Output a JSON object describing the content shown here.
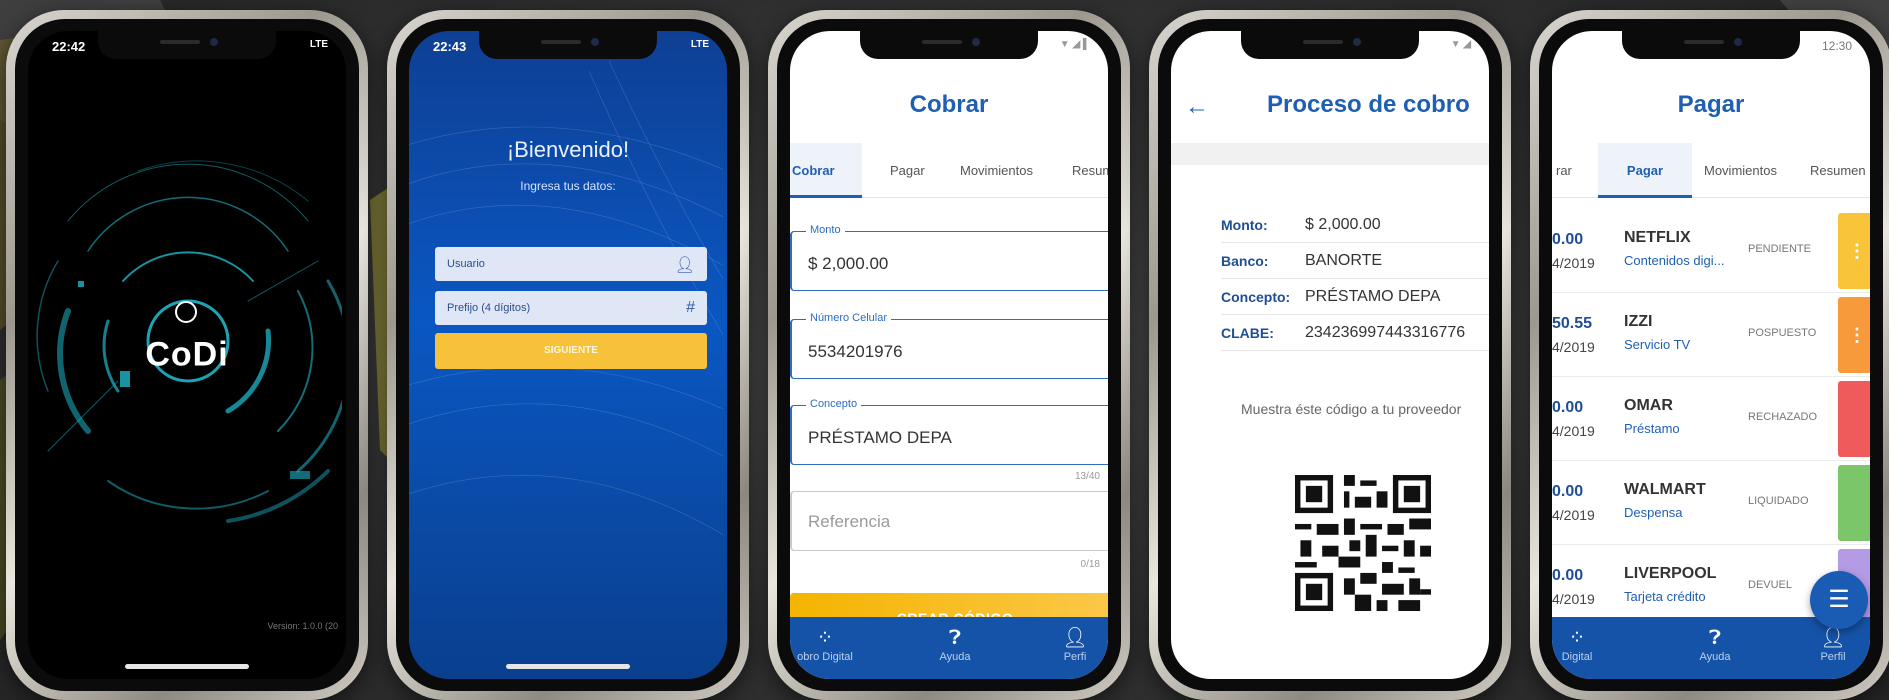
{
  "colors": {
    "primary_blue": "#1f5fb2",
    "accent_yellow": "#f8c13a",
    "nav_blue": "#1553a8",
    "status_pendiente": "#f8c53a",
    "status_pospuesto": "#f79a3b",
    "status_rechazado": "#ef5b5b",
    "status_liquidado": "#7cc66a",
    "status_devuelto": "#b59be3"
  },
  "phone1": {
    "time": "22:42",
    "status_right": "LTE",
    "logo_text": "CoDi",
    "version": "Version: 1.0.0 (20"
  },
  "phone2": {
    "time": "22:43",
    "status_right": "LTE",
    "welcome": "¡Bienvenido!",
    "subtitle": "Ingresa tus datos:",
    "user_placeholder": "Usuario",
    "prefix_placeholder": "Prefijo (4 dígitos)",
    "prefix_icon": "hash-icon",
    "user_icon": "person-icon",
    "button": "SIGUIENTE"
  },
  "phone3": {
    "title": "Cobrar",
    "tabs": [
      "Cobrar",
      "Pagar",
      "Movimientos",
      "Resum"
    ],
    "active_tab": "Cobrar",
    "monto_label": "Monto",
    "monto_value": "$ 2,000.00",
    "celular_label": "Número Celular",
    "celular_value": "5534201976",
    "concepto_label": "Concepto",
    "concepto_value": "PRÉSTAMO DEPA",
    "concepto_counter": "13/40",
    "referencia_placeholder": "Referencia",
    "referencia_counter": "0/18",
    "button": "CREAR CÓDIGO",
    "nav": [
      "obro Digital",
      "Ayuda",
      "Perfi"
    ]
  },
  "phone4": {
    "title": "Proceso de cobro",
    "details": [
      {
        "key": "Monto:",
        "value": "$ 2,000.00"
      },
      {
        "key": "Banco:",
        "value": "BANORTE"
      },
      {
        "key": "Concepto:",
        "value": "PRÉSTAMO DEPA"
      },
      {
        "key": "CLABE:",
        "value": "234236997443316776"
      }
    ],
    "instruction": "Muestra éste código a tu proveedor"
  },
  "phone5": {
    "title": "Pagar",
    "status_time": "12:30",
    "tabs": [
      "rar",
      "Pagar",
      "Movimientos",
      "Resumen"
    ],
    "active_tab": "Pagar",
    "payments": [
      {
        "amount": "0.00",
        "date": "4/2019",
        "name": "NETFLIX",
        "desc": "Contenidos digi...",
        "status": "PENDIENTE"
      },
      {
        "amount": "50.55",
        "date": "4/2019",
        "name": "IZZI",
        "desc": "Servicio TV",
        "status": "POSPUESTO"
      },
      {
        "amount": "0.00",
        "date": "4/2019",
        "name": "OMAR",
        "desc": "Préstamo",
        "status": "RECHAZADO"
      },
      {
        "amount": "0.00",
        "date": "4/2019",
        "name": "WALMART",
        "desc": "Despensa",
        "status": "LIQUIDADO"
      },
      {
        "amount": "0.00",
        "date": "4/2019",
        "name": "LIVERPOOL",
        "desc": "Tarjeta crédito",
        "status": "DEVUEL"
      }
    ],
    "nav": [
      "Digital",
      "Ayuda",
      "Perfil"
    ]
  }
}
